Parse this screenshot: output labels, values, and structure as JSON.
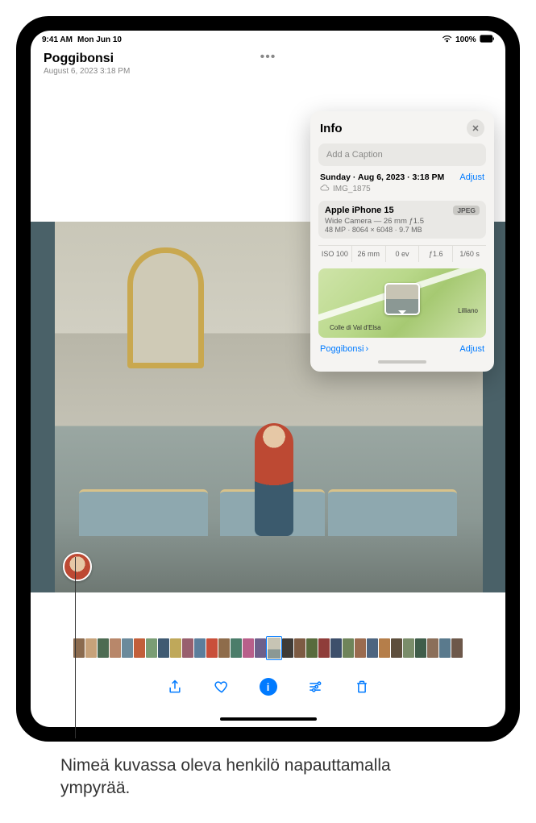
{
  "status": {
    "time": "9:41 AM",
    "date": "Mon Jun 10",
    "battery": "100%"
  },
  "header": {
    "title": "Poggibonsi",
    "subtitle": "August 6, 2023  3:18 PM"
  },
  "info": {
    "title": "Info",
    "caption_placeholder": "Add a Caption",
    "date_line": "Sunday · Aug 6, 2023 · 3:18 PM",
    "adjust": "Adjust",
    "filename": "IMG_1875",
    "device": "Apple iPhone 15",
    "format": "JPEG",
    "lens": "Wide Camera — 26 mm ƒ1.5",
    "mp": "48 MP",
    "resolution": "8064 × 6048",
    "size": "9.7 MB",
    "exif": {
      "iso": "ISO 100",
      "focal": "26 mm",
      "ev": "0 ev",
      "aperture": "ƒ1.6",
      "shutter": "1/60 s"
    },
    "map": {
      "label1": "Colle di Val d'Elsa",
      "label2": "Lilliano"
    },
    "location": "Poggibonsi"
  },
  "annotation": "Nimeä kuvassa oleva henkilö napauttamalla ympyrää."
}
